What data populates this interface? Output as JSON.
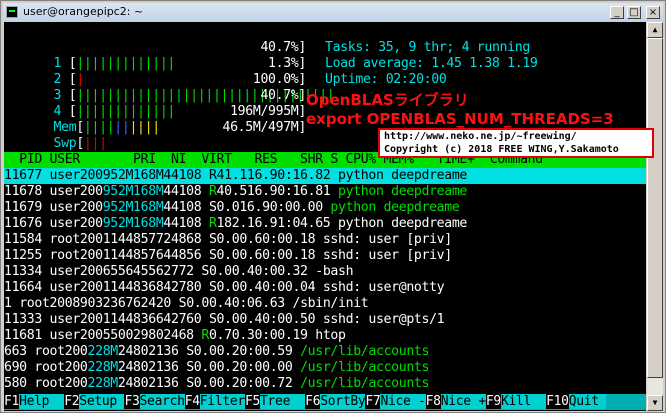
{
  "window": {
    "title": "user@orangepipc2: ~",
    "buttons": [
      "_",
      "□",
      "×"
    ]
  },
  "meters": [
    {
      "label": "1",
      "bars_left": "[",
      "bars": "|||||||||||||",
      "value": "40.7%]"
    },
    {
      "label": "2",
      "bars_left": "[",
      "bars": "|",
      "value": "1.3%]"
    },
    {
      "label": "3",
      "bars_left": "[",
      "bars": "||||||||||||||||||||||||||||||||||",
      "value": "100.0%]"
    },
    {
      "label": "4",
      "bars_left": "[",
      "bars": "|||||||||||||",
      "value": "40.7%]"
    },
    {
      "label": "Mem",
      "bars_left": "[",
      "bars": "||||||||||",
      "value": "196M/995M]"
    },
    {
      "label": "Swp",
      "bars_left": "[",
      "bars": "|||",
      "value": "46.5M/497M]"
    }
  ],
  "stats": {
    "tasks": "Tasks: 35, 9 thr; 4 running",
    "load": "Load average: 1.45 1.38 1.19",
    "uptime": "Uptime: 02:20:00"
  },
  "annotation": {
    "line1": "OpenBLASライブラリ",
    "line2": "export OPENBLAS_NUM_THREADS=3",
    "url": "http://www.neko.ne.jp/~freewing/",
    "copyright": "Copyright (c) 2018 FREE WING,Y.Sakamoto"
  },
  "header": "  PID USER       PRI  NI  VIRT   RES   SHR S CPU% MEM%   TIME+  Command",
  "rows": [
    {
      "pid": "11677",
      "user": "user",
      "pri": "20",
      "ni": "0",
      "virt": "952M",
      "res": "168M",
      "shr": "44108",
      "s": "R",
      "cpu": "41.1",
      "mem": "16.9",
      "time": "0:16.82",
      "cmd": "python deepdreame",
      "sel": true
    },
    {
      "pid": "11678",
      "user": "user",
      "pri": "20",
      "ni": "0",
      "virt": "952M",
      "res": "168M",
      "shr": "44108",
      "s": "R",
      "cpu": "40.5",
      "mem": "16.9",
      "time": "0:16.81",
      "cmd": "python deepdreame"
    },
    {
      "pid": "11679",
      "user": "user",
      "pri": "20",
      "ni": "0",
      "virt": "952M",
      "res": "168M",
      "shr": "44108",
      "s": "S",
      "cpu": "0.0",
      "mem": "16.9",
      "time": "0:00.00",
      "cmd": "python deepdreame"
    },
    {
      "pid": "11676",
      "user": "user",
      "pri": "20",
      "ni": "0",
      "virt": "952M",
      "res": "168M",
      "shr": "44108",
      "s": "R",
      "cpu": "182.",
      "mem": "16.9",
      "time": "1:04.65",
      "cmd": "python deepdreame",
      "white": true
    },
    {
      "pid": "11584",
      "user": "root",
      "pri": "20",
      "ni": "0",
      "virt": "11448",
      "res": "5772",
      "shr": "4868",
      "s": "S",
      "cpu": "0.0",
      "mem": "0.6",
      "time": "0:00.18",
      "cmd": "sshd: user [priv]",
      "white": true
    },
    {
      "pid": "11255",
      "user": "root",
      "pri": "20",
      "ni": "0",
      "virt": "11448",
      "res": "5764",
      "shr": "4856",
      "s": "S",
      "cpu": "0.0",
      "mem": "0.6",
      "time": "0:00.18",
      "cmd": "sshd: user [priv]",
      "white": true
    },
    {
      "pid": "11334",
      "user": "user",
      "pri": "20",
      "ni": "0",
      "virt": "6556",
      "res": "4556",
      "shr": "2772",
      "s": "S",
      "cpu": "0.0",
      "mem": "0.4",
      "time": "0:00.32",
      "cmd": "-bash",
      "white": true
    },
    {
      "pid": "11664",
      "user": "user",
      "pri": "20",
      "ni": "0",
      "virt": "11448",
      "res": "3684",
      "shr": "2780",
      "s": "S",
      "cpu": "0.0",
      "mem": "0.4",
      "time": "0:00.04",
      "cmd": "sshd: user@notty",
      "white": true
    },
    {
      "pid": "1",
      "user": "root",
      "pri": "20",
      "ni": "0",
      "virt": "89032",
      "res": "3676",
      "shr": "2420",
      "s": "S",
      "cpu": "0.0",
      "mem": "0.4",
      "time": "0:06.63",
      "cmd": "/sbin/init",
      "white": true
    },
    {
      "pid": "11333",
      "user": "user",
      "pri": "20",
      "ni": "0",
      "virt": "11448",
      "res": "3664",
      "shr": "2760",
      "s": "S",
      "cpu": "0.0",
      "mem": "0.4",
      "time": "0:00.50",
      "cmd": "sshd: user@pts/1",
      "white": true
    },
    {
      "pid": "11681",
      "user": "user",
      "pri": "20",
      "ni": "0",
      "virt": "5500",
      "res": "2980",
      "shr": "2468",
      "s": "R",
      "cpu": "0.7",
      "mem": "0.3",
      "time": "0:00.19",
      "cmd": "htop",
      "white": true
    },
    {
      "pid": "663",
      "user": "root",
      "pri": "20",
      "ni": "0",
      "virt": "228M",
      "res": "2480",
      "shr": "2136",
      "s": "S",
      "cpu": "0.0",
      "mem": "0.2",
      "time": "0:00.59",
      "cmd": "/usr/lib/accounts"
    },
    {
      "pid": "690",
      "user": "root",
      "pri": "20",
      "ni": "0",
      "virt": "228M",
      "res": "2480",
      "shr": "2136",
      "s": "S",
      "cpu": "0.0",
      "mem": "0.2",
      "time": "0:00.00",
      "cmd": "/usr/lib/accounts"
    },
    {
      "pid": "580",
      "user": "root",
      "pri": "20",
      "ni": "0",
      "virt": "228M",
      "res": "2480",
      "shr": "2136",
      "s": "S",
      "cpu": "0.0",
      "mem": "0.2",
      "time": "0:00.72",
      "cmd": "/usr/lib/accounts"
    }
  ],
  "fkeys": [
    {
      "key": "F1",
      "label": "Help  "
    },
    {
      "key": "F2",
      "label": "Setup "
    },
    {
      "key": "F3",
      "label": "Search"
    },
    {
      "key": "F4",
      "label": "Filter"
    },
    {
      "key": "F5",
      "label": "Tree  "
    },
    {
      "key": "F6",
      "label": "SortBy"
    },
    {
      "key": "F7",
      "label": "Nice -"
    },
    {
      "key": "F8",
      "label": "Nice +"
    },
    {
      "key": "F9",
      "label": "Kill  "
    },
    {
      "key": "F10",
      "label": "Quit "
    }
  ]
}
